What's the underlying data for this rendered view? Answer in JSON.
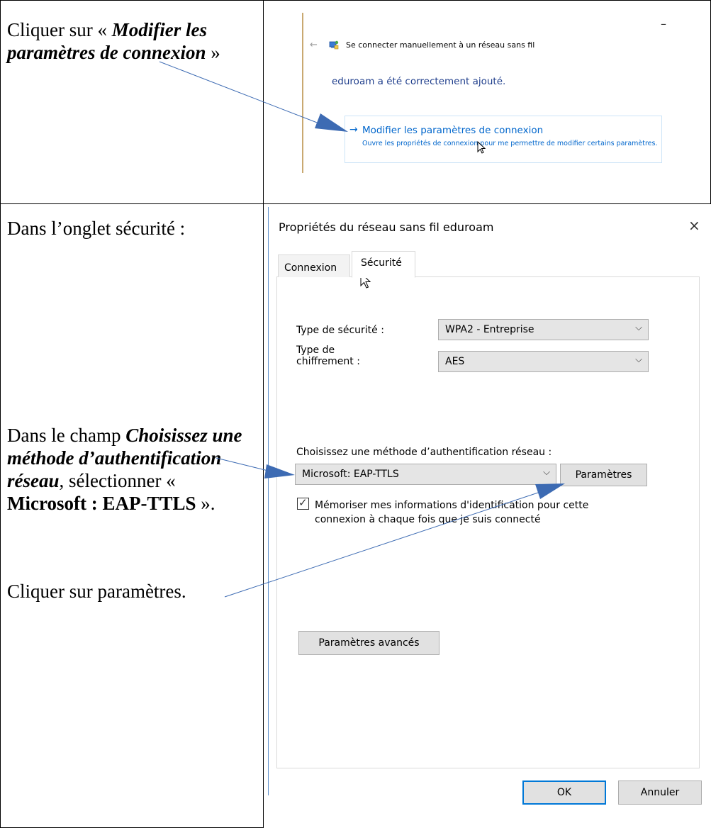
{
  "instructions": {
    "step1": {
      "pre": "Cliquer sur « ",
      "bold_italic": "Modifier les paramètres de connexion",
      "post": " »"
    },
    "step2": {
      "text": "Dans l’onglet sécurité :"
    },
    "step3": {
      "pre": "Dans le champ ",
      "bold_italic": "Choisissez une méthode d’authentification réseau",
      "mid": ", sélectionner « ",
      "bold": "Microsoft : EAP-TTLS",
      "post": " »."
    },
    "step4": {
      "text": "Cliquer sur paramètres."
    }
  },
  "wizard": {
    "minimize": "–",
    "back_icon": "back-arrow-icon",
    "title": "Se connecter manuellement à un réseau sans fil",
    "added_message": "eduroam a été correctement ajouté.",
    "link": {
      "title": "Modifier les paramètres de connexion",
      "description": "Ouvre les propriétés de connexion pour me permettre de modifier certains paramètres."
    }
  },
  "dialog": {
    "title": "Propriétés du réseau sans fil eduroam",
    "close": "×",
    "tabs": [
      {
        "label": "Connexion"
      },
      {
        "label": "Sécurité"
      }
    ],
    "security_type_label": "Type de sécurité :",
    "security_type_value": "WPA2 - Entreprise",
    "encryption_label_line1": "Type de",
    "encryption_label_line2": "chiffrement :",
    "encryption_value": "AES",
    "auth_method_label": "Choisissez une méthode d’authentification réseau :",
    "auth_method_value": "Microsoft: EAP-TTLS",
    "settings_button": "Paramètres",
    "remember_checkbox_label": "Mémoriser mes informations d'identification pour cette connexion à chaque fois que je suis connecté",
    "remember_checked": true,
    "advanced_button": "Paramètres avancés",
    "ok_button": "OK",
    "cancel_button": "Annuler"
  },
  "colors": {
    "link_blue": "#0066cc",
    "dark_blue_text": "#1f3e8c",
    "callout_arrow": "#3d6bb3",
    "dialog_border": "#5b8dc9"
  }
}
